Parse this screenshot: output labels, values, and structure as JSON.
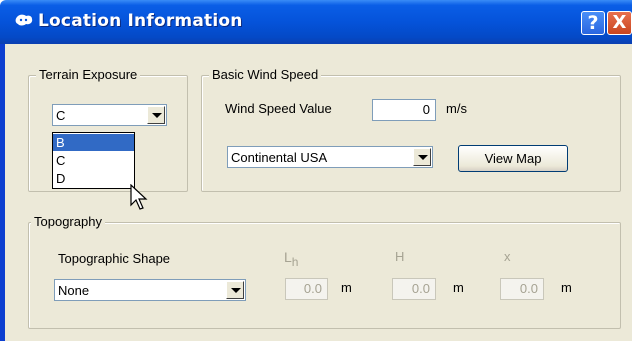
{
  "window": {
    "title": "Location Information",
    "help_glyph": "?",
    "close_glyph": "X"
  },
  "terrain": {
    "group_label": "Terrain Exposure",
    "selected": "C",
    "options": [
      "B",
      "C",
      "D"
    ],
    "highlighted": "B"
  },
  "wind": {
    "group_label": "Basic Wind Speed",
    "speed_label": "Wind Speed Value",
    "speed_value": "0",
    "speed_unit": "m/s",
    "region_selected": "Continental USA",
    "view_map_label": "View Map"
  },
  "topography": {
    "group_label": "Topography",
    "shape_label": "Topographic Shape",
    "shape_selected": "None",
    "lh_label": "L",
    "lh_sub": "h",
    "lh_value": "0.0",
    "lh_unit": "m",
    "h_label": "H",
    "h_value": "0.0",
    "h_unit": "m",
    "x_label": "x",
    "x_value": "0.0",
    "x_unit": "m"
  },
  "colors": {
    "titlebar": "#0553da",
    "selection": "#316ac5",
    "face": "#ece9d8"
  }
}
